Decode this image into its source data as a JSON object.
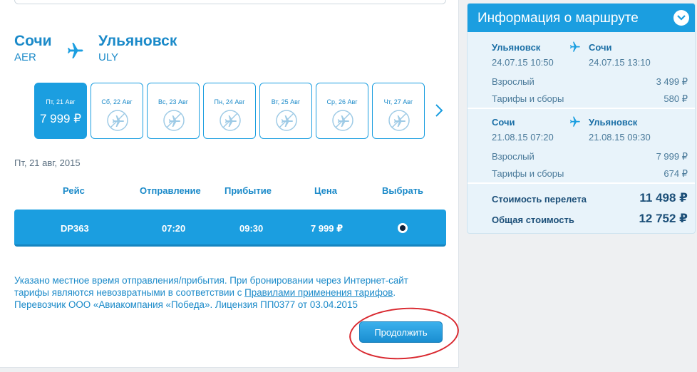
{
  "route": {
    "origin_city": "Сочи",
    "origin_code": "AER",
    "destination_city": "Ульяновск",
    "destination_code": "ULY"
  },
  "dates": [
    {
      "label": "Пт, 21 Авг",
      "price": "7 999 ₽",
      "selected": true
    },
    {
      "label": "Сб, 22 Авг",
      "price": "",
      "selected": false
    },
    {
      "label": "Вс, 23 Авг",
      "price": "",
      "selected": false
    },
    {
      "label": "Пн, 24 Авг",
      "price": "",
      "selected": false
    },
    {
      "label": "Вт, 25 Авг",
      "price": "",
      "selected": false
    },
    {
      "label": "Ср, 26 Авг",
      "price": "",
      "selected": false
    },
    {
      "label": "Чт, 27 Авг",
      "price": "",
      "selected": false
    }
  ],
  "selected_date": "Пт, 21 авг, 2015",
  "table": {
    "headers": {
      "flight": "Рейс",
      "departure": "Отправление",
      "arrival": "Прибытие",
      "price": "Цена",
      "select": "Выбрать"
    },
    "rows": [
      {
        "flight": "DP363",
        "departure": "07:20",
        "arrival": "09:30",
        "price": "7 999 ₽",
        "selected": true
      }
    ]
  },
  "notice": {
    "line1": "Указано местное время отправления/прибытия. При бронировании через Интернет-сайт",
    "line2_before": "тарифы являются невозвратными в соответствии с ",
    "line2_link": "Правилами применения тарифов",
    "line2_after": ".",
    "line3": "Перевозчик ООО «Авиакомпания «Победа». Лицензия ПП0377 от 03.04.2015"
  },
  "continue_label": "Продолжить",
  "sidebar": {
    "title": "Информация о маршруте",
    "outbound": {
      "from": "Ульяновск",
      "to": "Сочи",
      "dep": "24.07.15 10:50",
      "arr": "24.07.15 13:10",
      "adult_label": "Взрослый",
      "adult_price": "3 499 ₽",
      "fees_label": "Тарифы и сборы",
      "fees_price": "580 ₽"
    },
    "return": {
      "from": "Сочи",
      "to": "Ульяновск",
      "dep": "21.08.15 07:20",
      "arr": "21.08.15 09:30",
      "adult_label": "Взрослый",
      "adult_price": "7 999 ₽",
      "fees_label": "Тарифы и сборы",
      "fees_price": "674 ₽"
    },
    "flight_cost_label": "Стоимость перелета",
    "flight_cost": "11 498 ₽",
    "total_label": "Общая стоимость",
    "total": "12 752 ₽"
  },
  "colors": {
    "accent": "#1b9ee0",
    "text_blue": "#1b8ac9",
    "annotation_red": "#d9282f"
  }
}
